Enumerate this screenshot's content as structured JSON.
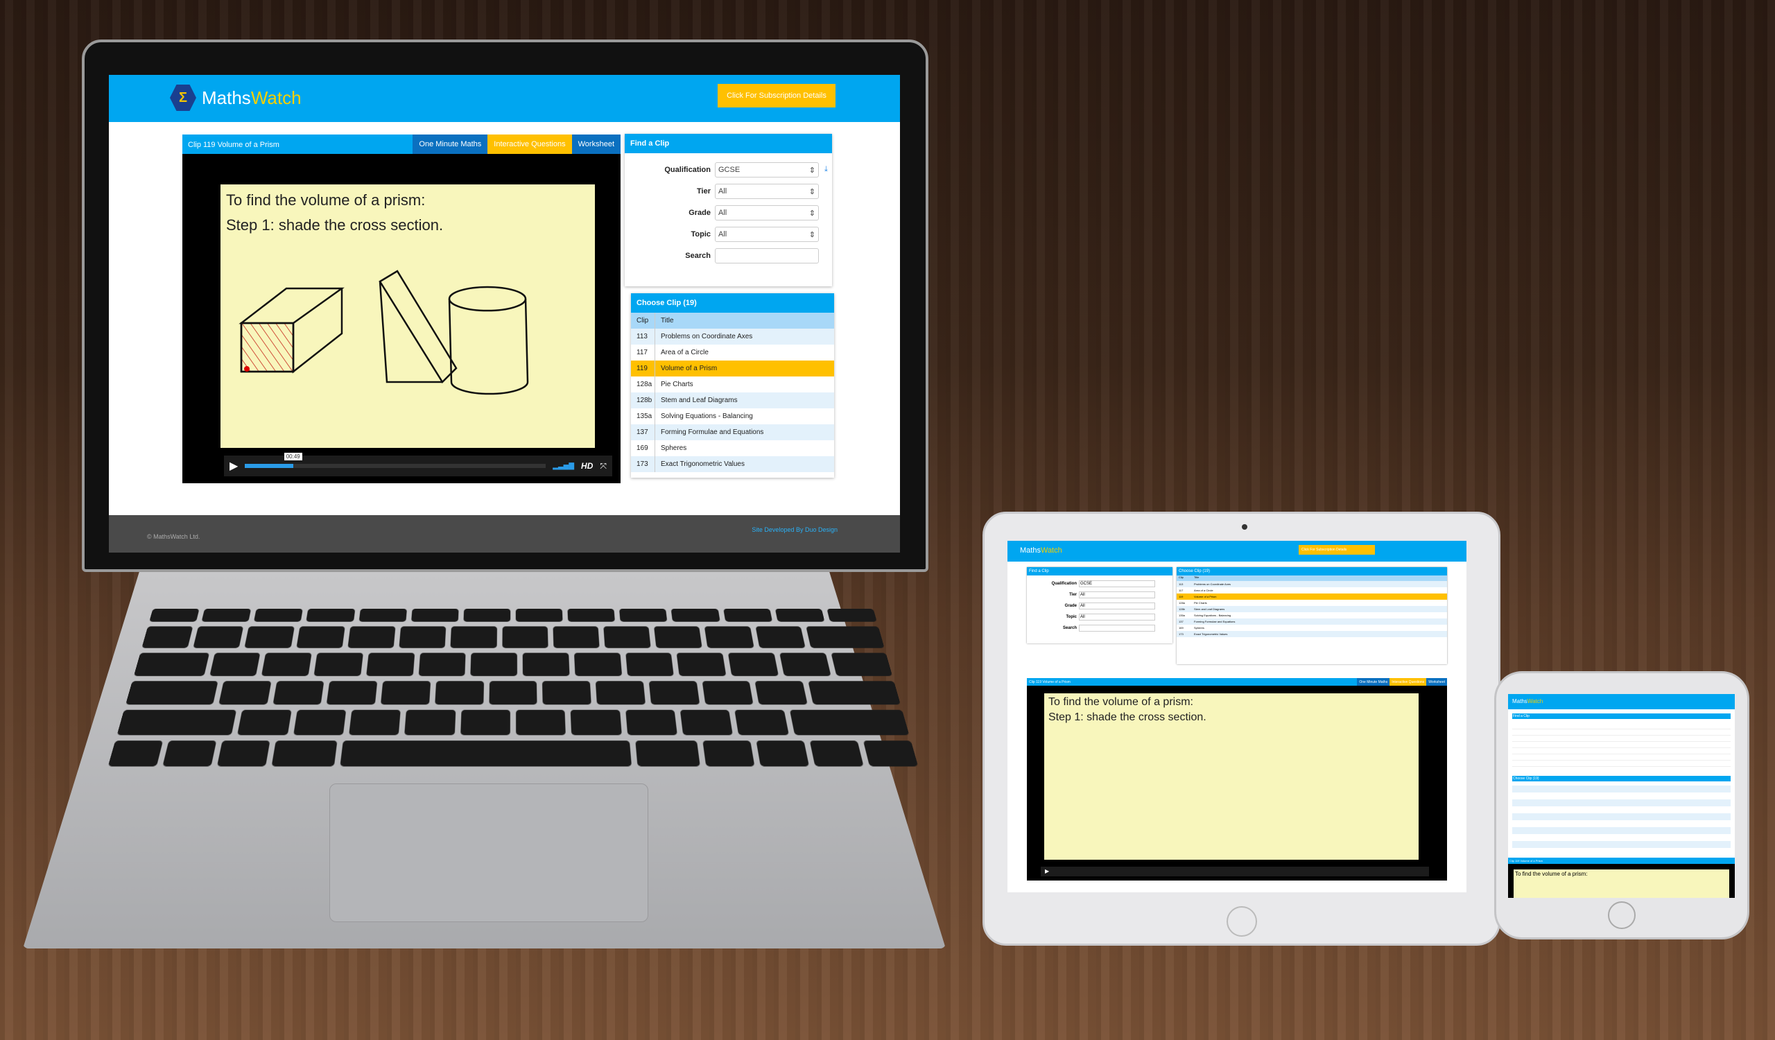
{
  "brand": {
    "name_a": "Maths",
    "name_b": "Watch",
    "subscription_button": "Click For Subscription Details"
  },
  "colors": {
    "primary": "#00a6f0",
    "accent": "#ffc000",
    "tab_dark": "#0a70c0",
    "footer": "#4a4a4a"
  },
  "video": {
    "title": "Clip 119 Volume of a Prism",
    "tabs": [
      "One Minute Maths",
      "Interactive Questions",
      "Worksheet"
    ],
    "slide_line1": "To find the volume of a prism:",
    "slide_line2": "Step 1:  shade the cross section.",
    "time": "00:49",
    "progress_percent": 16,
    "hd": "HD"
  },
  "find": {
    "title": "Find a Clip",
    "fields": [
      {
        "label": "Qualification",
        "value": "GCSE"
      },
      {
        "label": "Tier",
        "value": "All"
      },
      {
        "label": "Grade",
        "value": "All"
      },
      {
        "label": "Topic",
        "value": "All"
      },
      {
        "label": "Search",
        "value": ""
      }
    ]
  },
  "clips": {
    "title": "Choose Clip (19)",
    "col_clip": "Clip",
    "col_title": "Title",
    "selected": "119",
    "rows": [
      {
        "clip": "113",
        "title": "Problems on Coordinate Axes"
      },
      {
        "clip": "117",
        "title": "Area of a Circle"
      },
      {
        "clip": "119",
        "title": "Volume of a Prism"
      },
      {
        "clip": "128a",
        "title": "Pie Charts"
      },
      {
        "clip": "128b",
        "title": "Stem and Leaf Diagrams"
      },
      {
        "clip": "135a",
        "title": "Solving Equations - Balancing"
      },
      {
        "clip": "137",
        "title": "Forming Formulae and Equations"
      },
      {
        "clip": "169",
        "title": "Spheres"
      },
      {
        "clip": "173",
        "title": "Exact Trigonometric Values"
      }
    ]
  },
  "footer": {
    "copyright": "© MathsWatch Ltd.",
    "credit": "Site Developed By Duo Design"
  }
}
